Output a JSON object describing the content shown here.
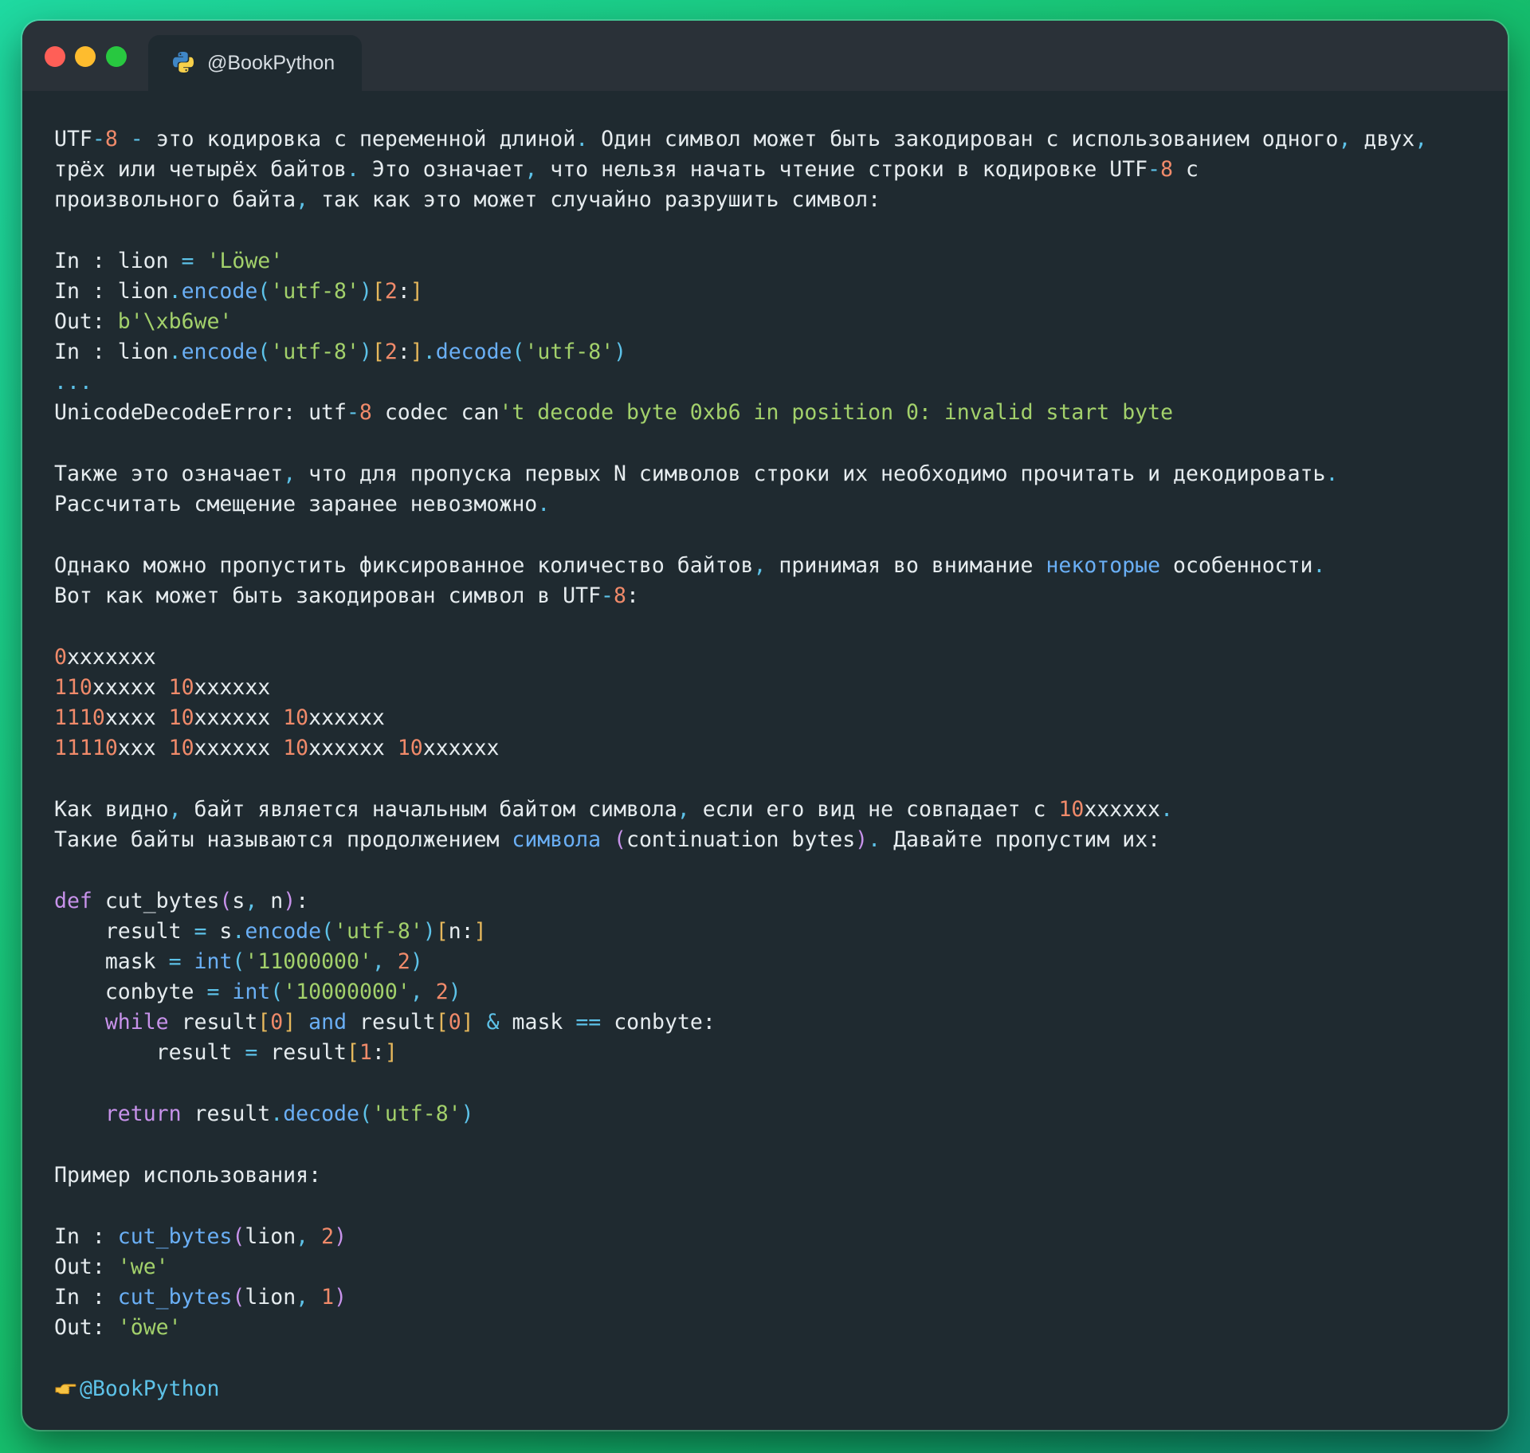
{
  "window": {
    "tab_title": "@BookPython",
    "traffic_lights": [
      "close",
      "minimize",
      "maximize"
    ]
  },
  "colors": {
    "background_gradient": [
      "#1fd9a1",
      "#17c26e",
      "#0e8a70"
    ],
    "window_bg": "#1f2a30",
    "titlebar_bg": "#2a3138",
    "text": "#e6ecef",
    "number": "#f08a6a",
    "punctuation": "#5dc2e8",
    "string": "#a3d16b",
    "function": "#6aaff5",
    "keyword": "#c792ea",
    "bracket": "#e6b85c"
  },
  "lines": {
    "l1": {
      "t1": "UTF",
      "t2": "-",
      "t3": "8",
      "t4": " - ",
      "t5": "это кодировка с переменной длиной",
      "t6": ".",
      "t7": " Один символ может быть закодирован с использованием одного",
      "t8": ",",
      "t9": " двух",
      "t10": ","
    },
    "l2": {
      "t1": "трёх или четырёх байтов",
      "t2": ".",
      "t3": " Это означает",
      "t4": ",",
      "t5": " что нельзя начать чтение строки в кодировке UTF",
      "t6": "-",
      "t7": "8",
      "t8": " с"
    },
    "l3": {
      "t1": "произвольного байта",
      "t2": ",",
      "t3": " так как это может случайно разрушить символ:"
    },
    "l4": {
      "t1": "In : lion ",
      "t2": "=",
      "t3": " ",
      "t4": "'Löwe'"
    },
    "l5": {
      "t1": "In : lion",
      "t2": ".",
      "t3": "encode",
      "t4": "(",
      "t5": "'utf-8'",
      "t6": ")",
      "t7": "[",
      "t8": "2",
      "t9": ":",
      "t10": "]"
    },
    "l6": {
      "t1": "Out: ",
      "t2": "b'\\xb6we'"
    },
    "l7": {
      "t1": "In : lion",
      "t2": ".",
      "t3": "encode",
      "t4": "(",
      "t5": "'utf-8'",
      "t6": ")",
      "t7": "[",
      "t8": "2",
      "t9": ":",
      "t10": "]",
      "t11": ".",
      "t12": "decode",
      "t13": "(",
      "t14": "'utf-8'",
      "t15": ")"
    },
    "l8": {
      "t1": "..."
    },
    "l9": {
      "t1": "UnicodeDecodeError: utf",
      "t2": "-",
      "t3": "8",
      "t4": " codec can",
      "t5": "'t decode byte 0xb6 in position 0: invalid start byte"
    },
    "l10": {
      "t1": "Также это означает",
      "t2": ",",
      "t3": " что для пропуска первых N символов строки их необходимо прочитать и декодировать",
      "t4": "."
    },
    "l11": {
      "t1": "Рассчитать смещение заранее невозможно",
      "t2": "."
    },
    "l12": {
      "t1": "Однако можно пропустить фиксированное количество байтов",
      "t2": ",",
      "t3": " принимая во внимание ",
      "t4": "некоторые",
      "t5": " особенности",
      "t6": "."
    },
    "l13": {
      "t1": "Вот как может быть закодирован символ в UTF",
      "t2": "-",
      "t3": "8",
      "t4": ":"
    },
    "l14": {
      "t1": "0",
      "t2": "xxxxxxx"
    },
    "l15": {
      "t1": "110",
      "t2": "xxxxx ",
      "t3": "10",
      "t4": "xxxxxx"
    },
    "l16": {
      "t1": "1110",
      "t2": "xxxx ",
      "t3": "10",
      "t4": "xxxxxx ",
      "t5": "10",
      "t6": "xxxxxx"
    },
    "l17": {
      "t1": "11110",
      "t2": "xxx ",
      "t3": "10",
      "t4": "xxxxxx ",
      "t5": "10",
      "t6": "xxxxxx ",
      "t7": "10",
      "t8": "xxxxxx"
    },
    "l18": {
      "t1": "Как видно",
      "t2": ",",
      "t3": " байт является начальным байтом символа",
      "t4": ",",
      "t5": " если его вид не совпадает с ",
      "t6": "10",
      "t7": "xxxxxx",
      "t8": "."
    },
    "l19": {
      "t1": "Такие байты называются продолжением ",
      "t2": "символа",
      "t3": " ",
      "t4": "(",
      "t5": "continuation bytes",
      "t6": ")",
      "t7": ".",
      "t8": " Давайте пропустим их:"
    },
    "l20": {
      "t1": "def",
      "t2": " cut_bytes",
      "t3": "(",
      "t4": "s",
      "t5": ",",
      "t6": " n",
      "t7": ")",
      "t8": ":"
    },
    "l21": {
      "t1": "    result ",
      "t2": "=",
      "t3": " s",
      "t4": ".",
      "t5": "encode",
      "t6": "(",
      "t7": "'utf-8'",
      "t8": ")",
      "t9": "[",
      "t10": "n:",
      "t11": "]"
    },
    "l22": {
      "t1": "    mask ",
      "t2": "=",
      "t3": " ",
      "t4": "int",
      "t5": "(",
      "t6": "'11000000'",
      "t7": ",",
      "t8": " ",
      "t9": "2",
      "t10": ")"
    },
    "l23": {
      "t1": "    conbyte ",
      "t2": "=",
      "t3": " ",
      "t4": "int",
      "t5": "(",
      "t6": "'10000000'",
      "t7": ",",
      "t8": " ",
      "t9": "2",
      "t10": ")"
    },
    "l24": {
      "t1": "    ",
      "t2": "while",
      "t3": " result",
      "t4": "[",
      "t5": "0",
      "t6": "]",
      "t7": " ",
      "t8": "and",
      "t9": " result",
      "t10": "[",
      "t11": "0",
      "t12": "]",
      "t13": " ",
      "t14": "&",
      "t15": " mask ",
      "t16": "==",
      "t17": " conbyte:"
    },
    "l25": {
      "t1": "        result ",
      "t2": "=",
      "t3": " result",
      "t4": "[",
      "t5": "1",
      "t6": ":",
      "t7": "]"
    },
    "l26": {
      "t1": "    ",
      "t2": "return",
      "t3": " result",
      "t4": ".",
      "t5": "decode",
      "t6": "(",
      "t7": "'utf-8'",
      "t8": ")"
    },
    "l27": {
      "t1": "Пример использования:"
    },
    "l28": {
      "t1": "In : ",
      "t2": "cut_bytes",
      "t3": "(",
      "t4": "lion",
      "t5": ",",
      "t6": " ",
      "t7": "2",
      "t8": ")"
    },
    "l29": {
      "t1": "Out: ",
      "t2": "'we'"
    },
    "l30": {
      "t1": "In : ",
      "t2": "cut_bytes",
      "t3": "(",
      "t4": "lion",
      "t5": ",",
      "t6": " ",
      "t7": "1",
      "t8": ")"
    },
    "l31": {
      "t1": "Out: ",
      "t2": "'öwe'"
    },
    "l32": {
      "icon": "pointing-hand-icon",
      "t1": "@BookPython"
    }
  }
}
